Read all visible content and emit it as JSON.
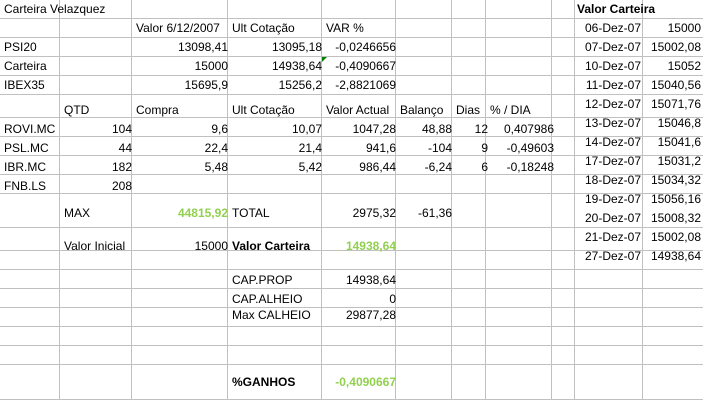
{
  "colors": {
    "grid": "#c0c0c0",
    "green": "#92d050",
    "comment": "#008000"
  },
  "title": "Carteira Velazquez",
  "header_row": {
    "valor_date": "Valor 6/12/2007",
    "ult_cotacao": "Ult Cotação",
    "var": "VAR %"
  },
  "indices": [
    {
      "name": "PSI20",
      "valor": "13098,41",
      "ult": "13095,18",
      "var": "-0,0246656"
    },
    {
      "name": "Carteira",
      "valor": "15000",
      "ult": "14938,64",
      "var": "-0,4090667"
    },
    {
      "name": "IBEX35",
      "valor": "15695,9",
      "ult": "15256,2",
      "var": "-2,8821069"
    }
  ],
  "pos_header": {
    "qtd": "QTD",
    "compra": "Compra",
    "ult": "Ult Cotação",
    "valor_actual": "Valor Actual",
    "balanco": "Balanço",
    "dias": "Dias",
    "pct_dia": "% / DIA"
  },
  "positions": [
    {
      "ticker": "ROVI.MC",
      "qtd": "104",
      "compra": "9,6",
      "ult": "10,07",
      "valor": "1047,28",
      "balanco": "48,88",
      "dias": "12",
      "pct": "0,407986"
    },
    {
      "ticker": "PSL.MC",
      "qtd": "44",
      "compra": "22,4",
      "ult": "21,4",
      "valor": "941,6",
      "balanco": "-104",
      "dias": "9",
      "pct": "-0,49603"
    },
    {
      "ticker": "IBR.MC",
      "qtd": "182",
      "compra": "5,48",
      "ult": "5,42",
      "valor": "986,44",
      "balanco": "-6,24",
      "dias": "6",
      "pct": "-0,18248"
    },
    {
      "ticker": "FNB.LS",
      "qtd": "208",
      "compra": "",
      "ult": "",
      "valor": "",
      "balanco": "",
      "dias": "",
      "pct": ""
    }
  ],
  "max": {
    "label": "MAX",
    "value": "44815,92",
    "total_label": "TOTAL",
    "total_value": "2975,32",
    "balanco_total": "-61,36"
  },
  "valor_inicial": {
    "label": "Valor Inicial",
    "value": "15000",
    "carteira_label": "Valor Carteira",
    "carteira_value": "14938,64"
  },
  "capital": [
    {
      "label": "CAP.PROP",
      "value": "14938,64"
    },
    {
      "label": "CAP.ALHEIO",
      "value": "0"
    },
    {
      "label": "Max CALHEIO",
      "value": "29877,28"
    }
  ],
  "ganhos": {
    "label": "%GANHOS",
    "value": "-0,4090667"
  },
  "side_title": "Valor Carteira",
  "history": [
    {
      "date": "06-Dez-07",
      "value": "15000"
    },
    {
      "date": "07-Dez-07",
      "value": "15002,08"
    },
    {
      "date": "10-Dez-07",
      "value": "15052"
    },
    {
      "date": "11-Dez-07",
      "value": "15040,56"
    },
    {
      "date": "12-Dez-07",
      "value": "15071,76"
    },
    {
      "date": "13-Dez-07",
      "value": "15046,8"
    },
    {
      "date": "14-Dez-07",
      "value": "15041,6"
    },
    {
      "date": "17-Dez-07",
      "value": "15031,2"
    },
    {
      "date": "18-Dez-07",
      "value": "15034,32"
    },
    {
      "date": "19-Dez-07",
      "value": "15056,16"
    },
    {
      "date": "20-Dez-07",
      "value": "15008,32"
    },
    {
      "date": "21-Dez-07",
      "value": "15002,08"
    },
    {
      "date": "27-Dez-07",
      "value": "14938,64"
    }
  ]
}
